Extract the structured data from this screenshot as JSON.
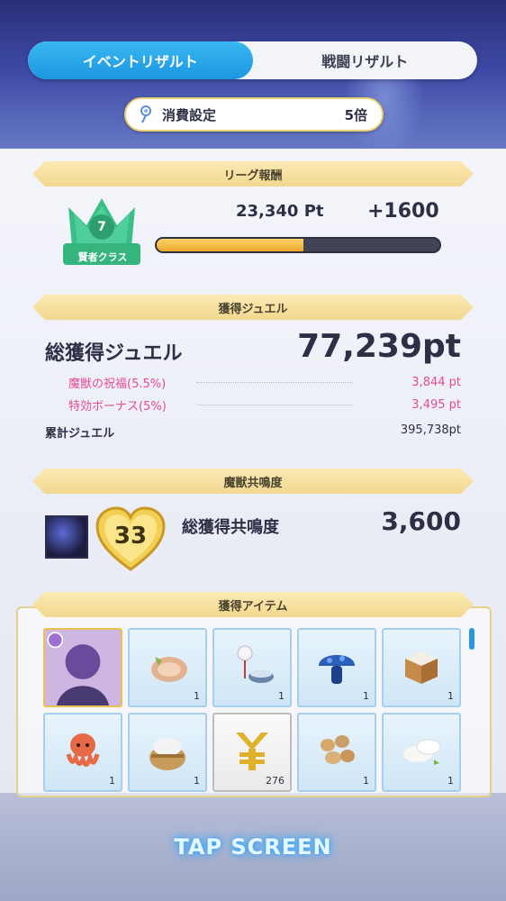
{
  "tabs": [
    {
      "label": "イベントリザルト",
      "active": true
    },
    {
      "label": "戦闘リザルト",
      "active": false
    }
  ],
  "consume": {
    "label": "消費設定",
    "value": "5倍",
    "icon": "wand-icon"
  },
  "league": {
    "header": "リーグ報酬",
    "rank_number": "7",
    "rank_name": "賢者クラス",
    "points": "23,340 Pt",
    "bonus": "+1600",
    "progress": 0.52
  },
  "jewel": {
    "header": "獲得ジュエル",
    "title": "総獲得ジュエル",
    "total": "77,239pt",
    "rows": [
      {
        "label": "魔獣の祝福(5.5%)",
        "value": "3,844 pt"
      },
      {
        "label": "特効ボーナス(5%)",
        "value": "3,495 pt"
      }
    ],
    "cumulative_label": "累計ジュエル",
    "cumulative_value": "395,738pt"
  },
  "resonance": {
    "header": "魔獣共鳴度",
    "level": "33",
    "title": "総獲得共鳴度",
    "value": "3,600"
  },
  "items": {
    "header": "獲得アイテム",
    "list": [
      {
        "name": "character-card-icon",
        "count": ""
      },
      {
        "name": "cured-meat-icon",
        "count": "1"
      },
      {
        "name": "wind-chime-bowl-icon",
        "count": "1"
      },
      {
        "name": "blue-mushroom-icon",
        "count": "1"
      },
      {
        "name": "rice-box-icon",
        "count": "1"
      },
      {
        "name": "octopus-icon",
        "count": "1"
      },
      {
        "name": "rice-sack-icon",
        "count": "1"
      },
      {
        "name": "yen-coin-icon",
        "count": "276"
      },
      {
        "name": "nuts-icon",
        "count": "1"
      },
      {
        "name": "tofu-icon",
        "count": "1"
      }
    ]
  },
  "tap_label": "TAP SCREEN"
}
